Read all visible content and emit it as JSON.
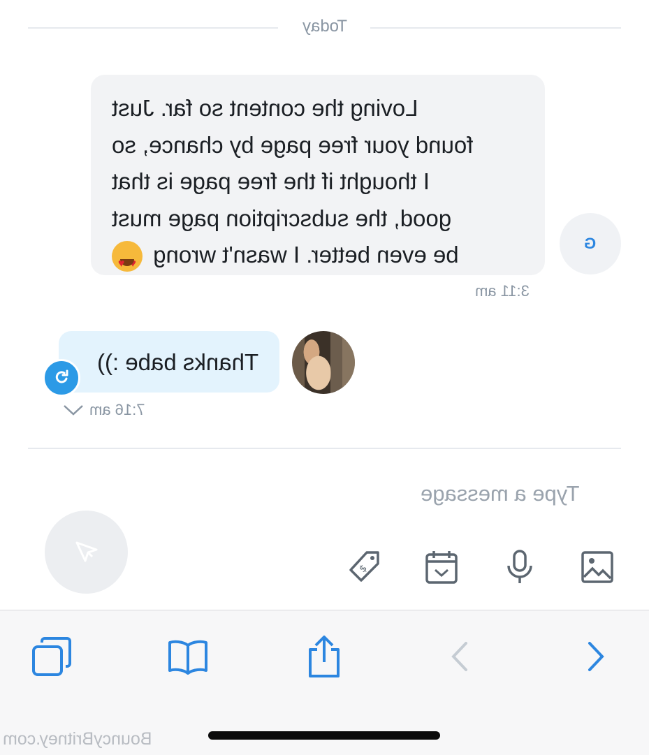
{
  "date_divider": "Today",
  "incoming": {
    "avatar_initial": "G",
    "lines": [
      "Loving the content so far. Just",
      "found your free page by chance, so",
      "I thought if the free page is that",
      "good, the subscription page must",
      "be even better. I wasn't wrong"
    ],
    "emoji": "heart-eyes-emoji",
    "time": "3:11 am"
  },
  "outgoing": {
    "text": "Thanks babe :))",
    "time": "7:16 am"
  },
  "composer": {
    "placeholder": "Type a message"
  },
  "toolbar_icons": [
    "image-icon",
    "microphone-icon",
    "calendar-icon",
    "price-tag-icon",
    "send-icon"
  ],
  "browser_nav_icons": [
    "forward-icon",
    "back-icon",
    "share-icon",
    "bookmarks-icon",
    "tabs-icon"
  ],
  "watermark": "BouncyBritney.com",
  "colors": {
    "accent": "#2c86e0",
    "incoming_bubble": "#f2f3f5",
    "outgoing_bubble": "#e3f3fd"
  }
}
